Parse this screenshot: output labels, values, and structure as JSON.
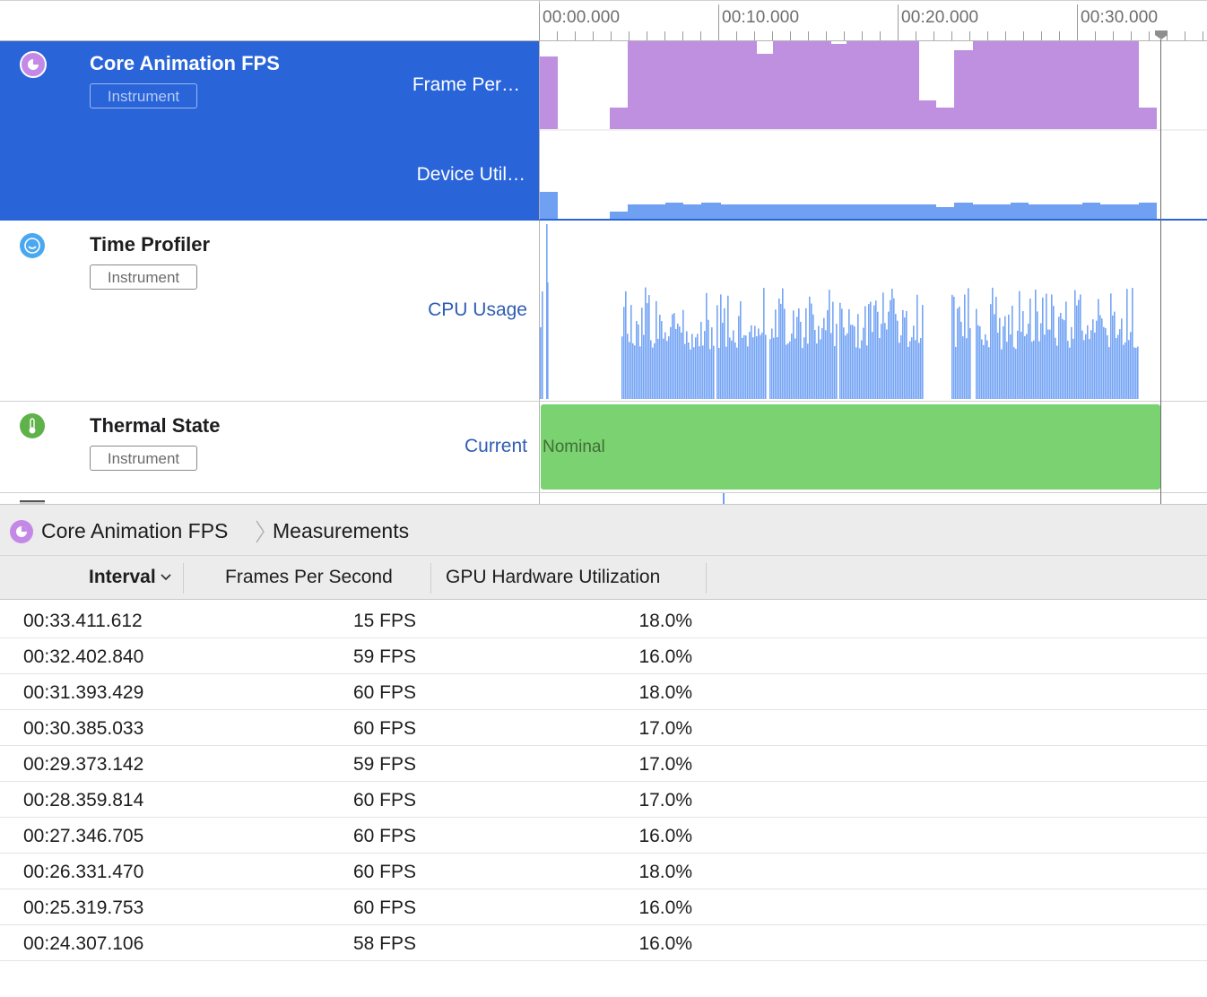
{
  "ruler": {
    "labels": [
      "00:00.000",
      "00:10.000",
      "00:20.000",
      "00:30.000"
    ]
  },
  "tracks": [
    {
      "title": "Core Animation FPS",
      "badge": "Instrument",
      "icon": "core-animation-icon",
      "selected": true,
      "lanes": [
        "Frame Per…",
        "Device Util…"
      ]
    },
    {
      "title": "Time Profiler",
      "badge": "Instrument",
      "icon": "time-profiler-icon",
      "lanes": [
        "CPU Usage"
      ]
    },
    {
      "title": "Thermal State",
      "badge": "Instrument",
      "icon": "thermometer-icon",
      "lanes": [
        "Current"
      ],
      "state_text": "Nominal"
    }
  ],
  "colors": {
    "selection": "#2964d9",
    "fps": "#bf8fe0",
    "gpu": "#6fa0f2",
    "cpu": "#76a5f5",
    "thermal": "#7bd270"
  },
  "detail": {
    "instrument": "Core Animation FPS",
    "view": "Measurements"
  },
  "table": {
    "columns": [
      "Interval",
      "Frames Per Second",
      "GPU Hardware Utilization"
    ],
    "rows": [
      [
        "00:33.411.612",
        "15 FPS",
        "18.0%"
      ],
      [
        "00:32.402.840",
        "59 FPS",
        "16.0%"
      ],
      [
        "00:31.393.429",
        "60 FPS",
        "18.0%"
      ],
      [
        "00:30.385.033",
        "60 FPS",
        "17.0%"
      ],
      [
        "00:29.373.142",
        "59 FPS",
        "17.0%"
      ],
      [
        "00:28.359.814",
        "60 FPS",
        "17.0%"
      ],
      [
        "00:27.346.705",
        "60 FPS",
        "16.0%"
      ],
      [
        "00:26.331.470",
        "60 FPS",
        "18.0%"
      ],
      [
        "00:25.319.753",
        "60 FPS",
        "16.0%"
      ],
      [
        "00:24.307.106",
        "58 FPS",
        "16.0%"
      ]
    ]
  }
}
